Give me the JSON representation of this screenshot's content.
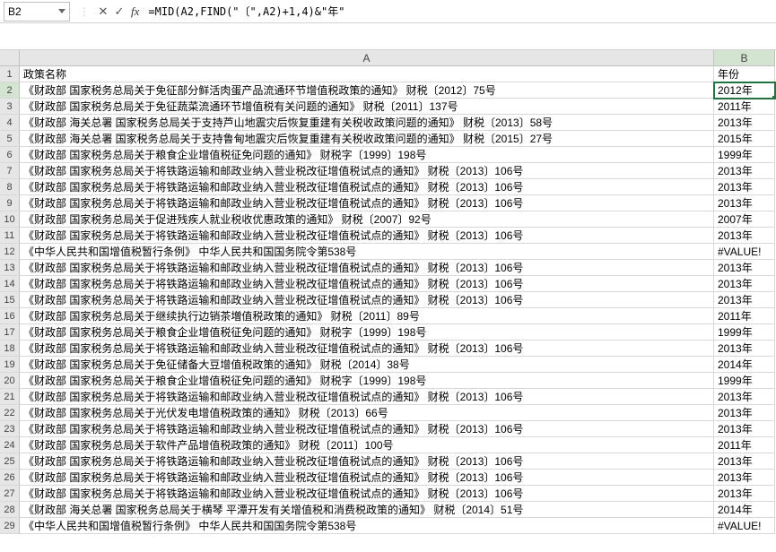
{
  "nameBox": "B2",
  "formula": "=MID(A2,FIND(\"〔\",A2)+1,4)&\"年\"",
  "columns": [
    "A",
    "B"
  ],
  "headerRow": {
    "A": "政策名称",
    "B": "年份"
  },
  "activeColIndex": 1,
  "activeRowIndex": 1,
  "rows": [
    {
      "A": "《财政部 国家税务总局关于免征部分鲜活肉蛋产品流通环节增值税政策的通知》 财税〔2012〕75号",
      "B": "2012年"
    },
    {
      "A": "《财政部 国家税务总局关于免征蔬菜流通环节增值税有关问题的通知》 财税〔2011〕137号",
      "B": "2011年"
    },
    {
      "A": "《财政部 海关总署 国家税务总局关于支持芦山地震灾后恢复重建有关税收政策问题的通知》 财税〔2013〕58号",
      "B": "2013年"
    },
    {
      "A": "《财政部 海关总署 国家税务总局关于支持鲁甸地震灾后恢复重建有关税收政策问题的通知》 财税〔2015〕27号",
      "B": "2015年"
    },
    {
      "A": "《财政部 国家税务总局关于粮食企业增值税征免问题的通知》 财税字〔1999〕198号",
      "B": "1999年"
    },
    {
      "A": "《财政部 国家税务总局关于将铁路运输和邮政业纳入营业税改征增值税试点的通知》 财税〔2013〕106号",
      "B": "2013年"
    },
    {
      "A": "《财政部 国家税务总局关于将铁路运输和邮政业纳入营业税改征增值税试点的通知》 财税〔2013〕106号",
      "B": "2013年"
    },
    {
      "A": "《财政部 国家税务总局关于将铁路运输和邮政业纳入营业税改征增值税试点的通知》 财税〔2013〕106号",
      "B": "2013年"
    },
    {
      "A": "《财政部 国家税务总局关于促进残疾人就业税收优惠政策的通知》 财税〔2007〕92号",
      "B": "2007年"
    },
    {
      "A": "《财政部 国家税务总局关于将铁路运输和邮政业纳入营业税改征增值税试点的通知》 财税〔2013〕106号",
      "B": "2013年"
    },
    {
      "A": "《中华人民共和国增值税暂行条例》 中华人民共和国国务院令第538号",
      "B": "#VALUE!"
    },
    {
      "A": "《财政部 国家税务总局关于将铁路运输和邮政业纳入营业税改征增值税试点的通知》 财税〔2013〕106号",
      "B": "2013年"
    },
    {
      "A": "《财政部 国家税务总局关于将铁路运输和邮政业纳入营业税改征增值税试点的通知》 财税〔2013〕106号",
      "B": "2013年"
    },
    {
      "A": "《财政部 国家税务总局关于将铁路运输和邮政业纳入营业税改征增值税试点的通知》 财税〔2013〕106号",
      "B": "2013年"
    },
    {
      "A": "《财政部 国家税务总局关于继续执行边销茶増值税政策的通知》 财税〔2011〕89号",
      "B": "2011年"
    },
    {
      "A": "《财政部 国家税务总局关于粮食企业增值税征免问题的通知》 财税字〔1999〕198号",
      "B": "1999年"
    },
    {
      "A": "《财政部 国家税务总局关于将铁路运输和邮政业纳入营业税改征增值税试点的通知》 财税〔2013〕106号",
      "B": "2013年"
    },
    {
      "A": "《财政部 国家税务总局关于免征储备大豆增值税政策的通知》 财税〔2014〕38号",
      "B": "2014年"
    },
    {
      "A": "《财政部 国家税务总局关于粮食企业增值税征免问题的通知》 财税字〔1999〕198号",
      "B": "1999年"
    },
    {
      "A": "《财政部 国家税务总局关于将铁路运输和邮政业纳入营业税改征增值税试点的通知》 财税〔2013〕106号",
      "B": "2013年"
    },
    {
      "A": "《财政部 国家税务总局关于光伏发电增值税政策的通知》 财税〔2013〕66号",
      "B": "2013年"
    },
    {
      "A": "《财政部 国家税务总局关于将铁路运输和邮政业纳入营业税改征增值税试点的通知》 财税〔2013〕106号",
      "B": "2013年"
    },
    {
      "A": "《财政部 国家税务总局关于软件产品增值税政策的通知》 财税〔2011〕100号",
      "B": "2011年"
    },
    {
      "A": "《财政部 国家税务总局关于将铁路运输和邮政业纳入营业税改征增值税试点的通知》 财税〔2013〕106号",
      "B": "2013年"
    },
    {
      "A": "《财政部 国家税务总局关于将铁路运输和邮政业纳入营业税改征增值税试点的通知》 财税〔2013〕106号",
      "B": "2013年"
    },
    {
      "A": "《财政部 国家税务总局关于将铁路运输和邮政业纳入营业税改征增值税试点的通知》 财税〔2013〕106号",
      "B": "2013年"
    },
    {
      "A": "《财政部 海关总署 国家税务总局关于横琴 平潭开发有关增值税和消费税政策的通知》 财税〔2014〕51号",
      "B": "2014年"
    },
    {
      "A": "《中华人民共和国增值税暂行条例》 中华人民共和国国务院令第538号",
      "B": "#VALUE!"
    }
  ]
}
